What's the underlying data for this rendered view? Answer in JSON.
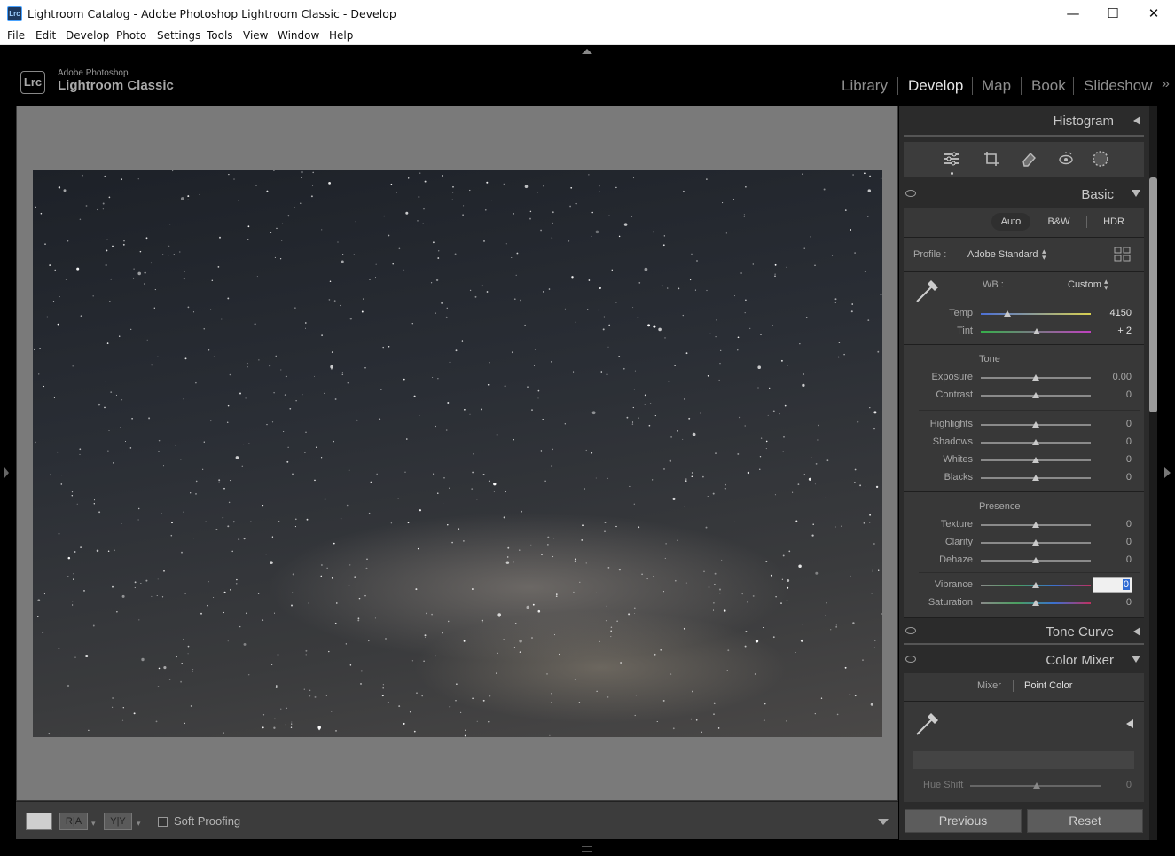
{
  "window": {
    "title": "Lightroom Catalog - Adobe Photoshop Lightroom Classic - Develop",
    "app_icon": "Lrc"
  },
  "menu": [
    "File",
    "Edit",
    "Develop",
    "Photo",
    "Settings",
    "Tools",
    "View",
    "Window",
    "Help"
  ],
  "brand": {
    "badge": "Lrc",
    "small": "Adobe Photoshop",
    "big": "Lightroom Classic"
  },
  "modules": [
    "Library",
    "Develop",
    "Map",
    "Book",
    "Slideshow"
  ],
  "active_module": "Develop",
  "toolbar": {
    "soft_proofing": "Soft Proofing",
    "soft_proofing_checked": false,
    "ra_label": "R|A",
    "yy_label": "Y|Y"
  },
  "panels": {
    "histogram": "Histogram",
    "basic": "Basic",
    "tone_curve": "Tone Curve",
    "color_mixer": "Color Mixer"
  },
  "basic": {
    "treatments": [
      "Auto",
      "B&W",
      "HDR"
    ],
    "profile_label": "Profile :",
    "profile_value": "Adobe Standard",
    "wb_label": "WB :",
    "wb_value": "Custom",
    "tone_label": "Tone",
    "presence_label": "Presence",
    "sliders": [
      {
        "label": "Temp",
        "value": "4150",
        "pos": 0.24
      },
      {
        "label": "Tint",
        "value": "+ 2",
        "pos": 0.51
      },
      {
        "label": "Exposure",
        "value": "0.00",
        "pos": 0.5
      },
      {
        "label": "Contrast",
        "value": "0",
        "pos": 0.5
      },
      {
        "label": "Highlights",
        "value": "0",
        "pos": 0.5
      },
      {
        "label": "Shadows",
        "value": "0",
        "pos": 0.5
      },
      {
        "label": "Whites",
        "value": "0",
        "pos": 0.5
      },
      {
        "label": "Blacks",
        "value": "0",
        "pos": 0.5
      },
      {
        "label": "Texture",
        "value": "0",
        "pos": 0.5
      },
      {
        "label": "Clarity",
        "value": "0",
        "pos": 0.5
      },
      {
        "label": "Dehaze",
        "value": "0",
        "pos": 0.5
      },
      {
        "label": "Vibrance",
        "value": "0",
        "pos": 0.5
      },
      {
        "label": "Saturation",
        "value": "0",
        "pos": 0.5
      }
    ]
  },
  "color_mixer": {
    "tabs": [
      "Mixer",
      "Point Color"
    ],
    "active_tab": "Point Color",
    "hue_shift_label": "Hue Shift",
    "hue_shift_value": "0"
  },
  "buttons": {
    "previous": "Previous",
    "reset": "Reset"
  },
  "tools": [
    "edit-sliders-icon",
    "crop-icon",
    "healing-eraser-icon",
    "red-eye-icon",
    "masking-icon"
  ]
}
